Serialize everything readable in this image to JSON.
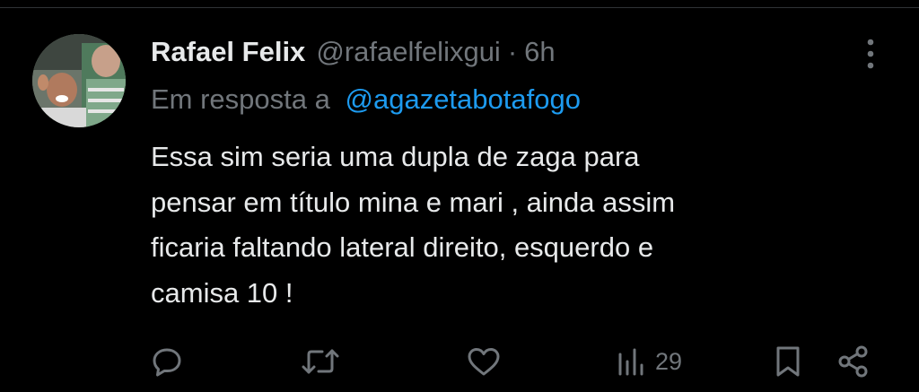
{
  "tweet": {
    "author_name": "Rafael Felix",
    "author_handle": "@rafaelfelixgui",
    "separator": "·",
    "time": "6h",
    "reply_prefix": "Em resposta a",
    "reply_to": "@agazetabotafogo",
    "body_lines": [
      "Essa sim seria uma dupla de zaga para",
      "pensar em título mina e mari , ainda assim",
      "ficaria faltando lateral direito, esquerdo e",
      "camisa 10 !"
    ]
  },
  "actions": {
    "reply_icon": "comment-icon",
    "retweet_icon": "retweet-icon",
    "like_icon": "heart-icon",
    "views_icon": "views-chart-icon",
    "views_count": "29",
    "bookmark_icon": "bookmark-icon",
    "share_icon": "share-icon"
  },
  "more_icon": "more-vertical-icon",
  "colors": {
    "background": "#000000",
    "text_primary": "#e7e9ea",
    "text_secondary": "#71767b",
    "link": "#1d9bf0"
  }
}
